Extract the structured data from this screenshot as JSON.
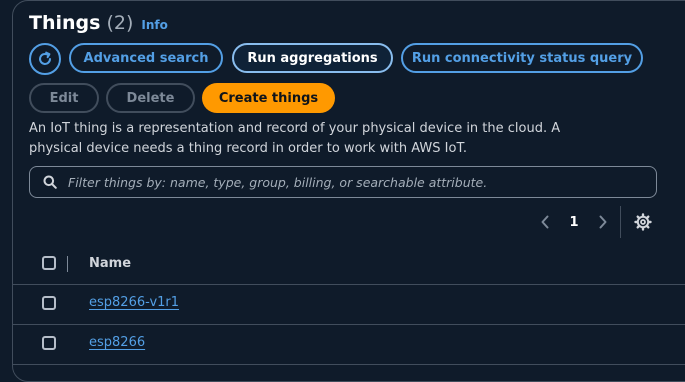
{
  "header": {
    "title": "Things",
    "count": "(2)",
    "info_label": "Info"
  },
  "toolbar": {
    "advanced_search_label": "Advanced search",
    "run_aggregations_label": "Run aggregations",
    "run_connectivity_label": "Run connectivity status query",
    "edit_label": "Edit",
    "delete_label": "Delete",
    "create_label": "Create things"
  },
  "description": "An IoT thing is a representation and record of your physical device in the cloud. A physical device needs a thing record in order to work with AWS IoT.",
  "search": {
    "placeholder": "Filter things by: name, type, group, billing, or searchable attribute.",
    "value": ""
  },
  "pagination": {
    "current_page": "1"
  },
  "table": {
    "columns": [
      "Name"
    ],
    "rows": [
      {
        "name": "esp8266-v1r1"
      },
      {
        "name": "esp8266"
      }
    ]
  },
  "icons": {
    "refresh": "refresh-icon",
    "search": "search-icon",
    "prev": "chevron-left-icon",
    "next": "chevron-right-icon",
    "settings": "gear-icon"
  },
  "colors": {
    "background": "#0f1b2a",
    "link": "#539fe5",
    "primary": "#ff9900",
    "border": "#414d5c"
  }
}
